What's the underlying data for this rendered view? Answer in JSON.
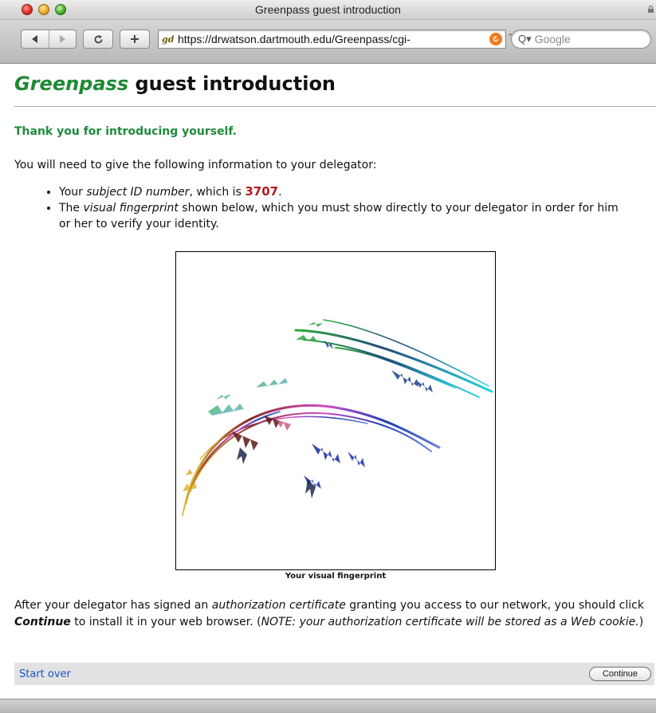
{
  "window": {
    "title": "Greenpass guest introduction"
  },
  "toolbar": {
    "back_icon": "back-arrow-icon",
    "forward_icon": "forward-arrow-icon",
    "reload_icon": "reload-icon",
    "add_icon": "plus-icon",
    "url": "https://drwatson.dartmouth.edu/Greenpass/cgi-",
    "search_placeholder": "Google"
  },
  "page": {
    "title_brand": "Greenpass",
    "title_rest": " guest introduction",
    "thanks": "Thank you for introducing yourself.",
    "intro": "You will need to give the following information to your delegator:",
    "bullet1": {
      "prefix": "Your ",
      "emph": "subject ID number",
      "middle": ", which is ",
      "id": "3707",
      "suffix": "."
    },
    "bullet2": {
      "prefix": "The ",
      "emph": "visual fingerprint",
      "rest": " shown below, which you must show directly to your delegator in order for him or her to verify your identity."
    },
    "fingerprint_caption": "Your visual fingerprint",
    "after": {
      "p1": "After your delegator has signed an ",
      "emph1": "authorization certificate",
      "p2": " granting you access to our network, you should click ",
      "strong": "Continue",
      "p3": " to install it in your web browser. (",
      "note": "NOTE: your authorization certificate will be stored as a Web cookie.",
      "p4": ")"
    },
    "start_over": "Start over",
    "continue": "Continue"
  },
  "colors": {
    "brand_green": "#1e8a33",
    "thanks_green": "#1f8a3c",
    "id_red": "#b5191b",
    "link_blue": "#1a55c8"
  }
}
